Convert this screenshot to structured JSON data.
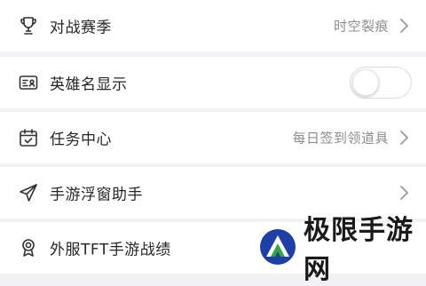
{
  "settings": {
    "items": [
      {
        "label": "对战赛季",
        "value": "时空裂痕",
        "icon": "trophy-icon",
        "control": "chevron"
      },
      {
        "label": "英雄名显示",
        "value": "",
        "icon": "id-card-icon",
        "control": "toggle",
        "toggle_on": false
      },
      {
        "label": "任务中心",
        "value": "每日签到领道具",
        "icon": "calendar-check-icon",
        "control": "chevron"
      },
      {
        "label": "手游浮窗助手",
        "value": "",
        "icon": "paper-plane-icon",
        "control": "chevron"
      },
      {
        "label": "外服TFT手游战绩",
        "value": "",
        "icon": "medal-icon",
        "control": "none"
      }
    ]
  },
  "watermark": {
    "text": "极限手游网"
  },
  "colors": {
    "background": "#f2f2f4",
    "row": "#ffffff",
    "value_text": "#8c8c8c",
    "logo_blue": "#1e3fa8",
    "logo_green": "#2faa3a"
  }
}
